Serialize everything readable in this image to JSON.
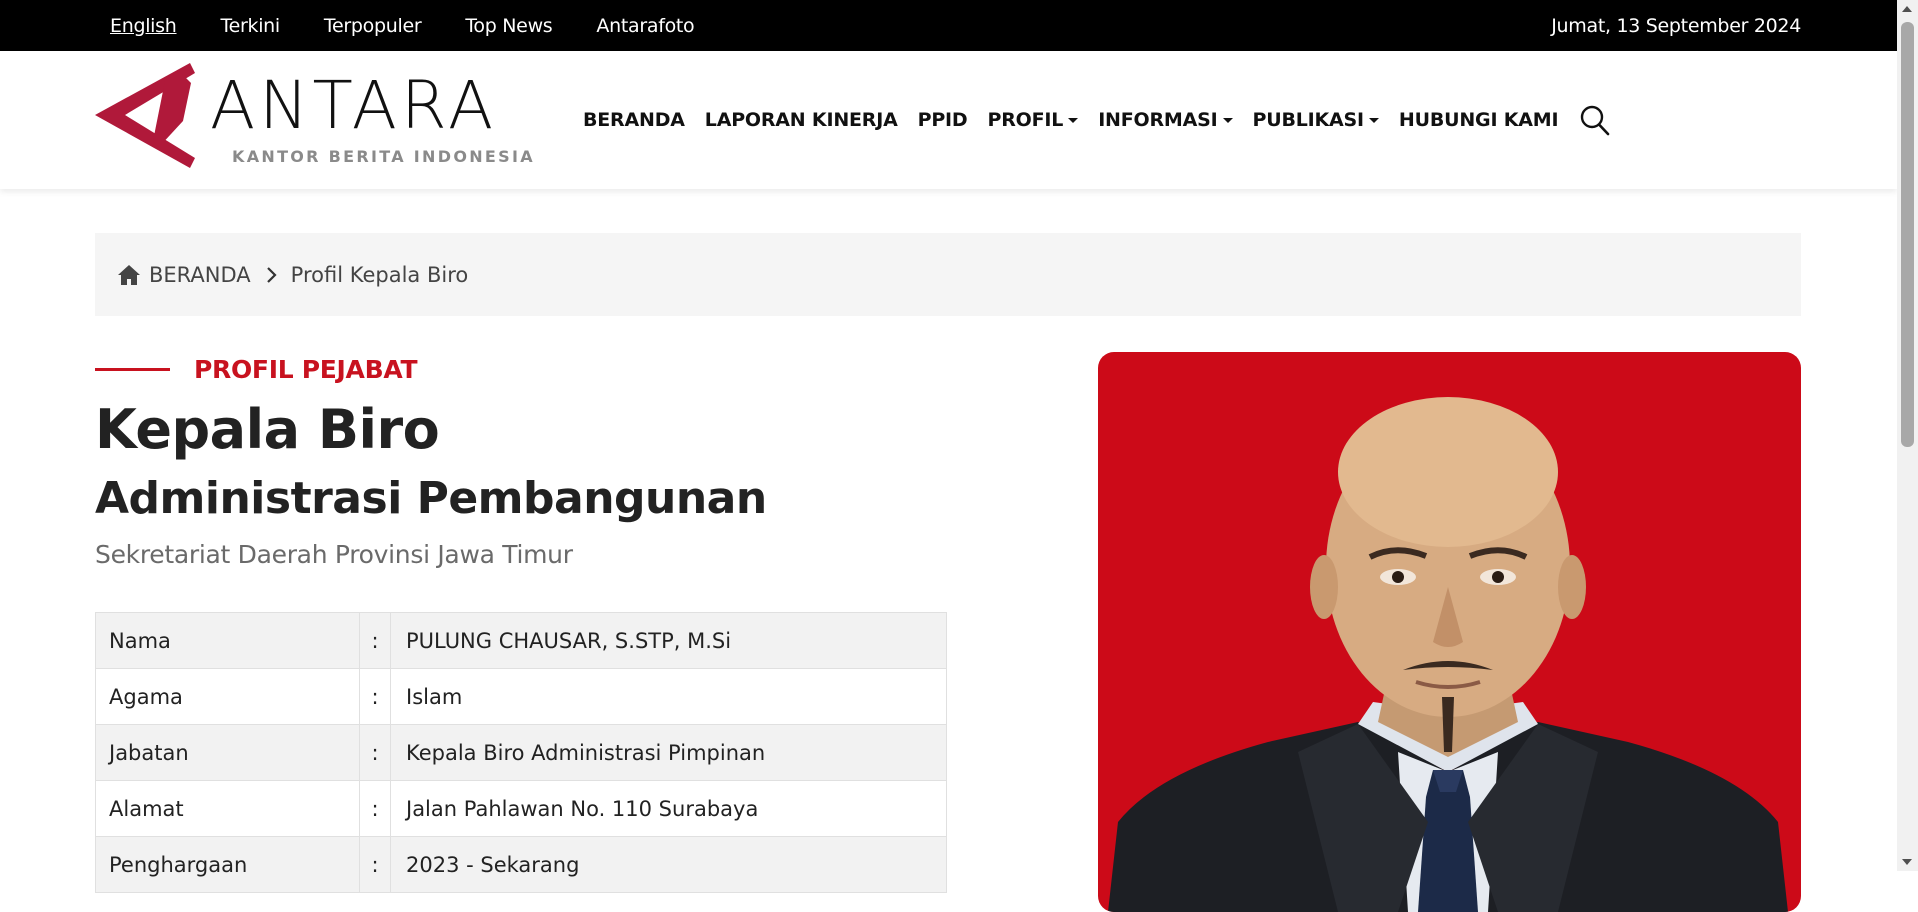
{
  "topbar": {
    "links": [
      "English",
      "Terkini",
      "Terpopuler",
      "Top News",
      "Antarafoto"
    ],
    "date": "Jumat, 13 September 2024"
  },
  "header": {
    "logo_word": "ANTARA",
    "logo_sub": "KANTOR BERITA INDONESIA",
    "nav": [
      "BERANDA",
      "LAPORAN KINERJA",
      "PPID",
      "PROFIL",
      "INFORMASI",
      "PUBLIKASI",
      "HUBUNGI KAMI"
    ]
  },
  "breadcrumb": {
    "home": "BERANDA",
    "current": "Profil Kepala Biro"
  },
  "profile": {
    "eyebrow": "PROFIL PEJABAT",
    "title1": "Kepala Biro",
    "title2": "Administrasi Pembangunan",
    "subtitle": "Sekretariat Daerah Provinsi Jawa Timur",
    "colon": ":",
    "rows": [
      {
        "label": "Nama",
        "value": "PULUNG CHAUSAR, S.STP, M.Si"
      },
      {
        "label": "Agama",
        "value": "Islam"
      },
      {
        "label": "Jabatan",
        "value": "Kepala Biro Administrasi Pimpinan"
      },
      {
        "label": "Alamat",
        "value": "Jalan Pahlawan No. 110 Surabaya"
      },
      {
        "label": "Penghargaan",
        "value": "2023 - Sekarang"
      }
    ]
  },
  "colors": {
    "brand_red": "#c8121f",
    "photo_bg": "#cc0a18",
    "topbar_bg": "#000000"
  }
}
